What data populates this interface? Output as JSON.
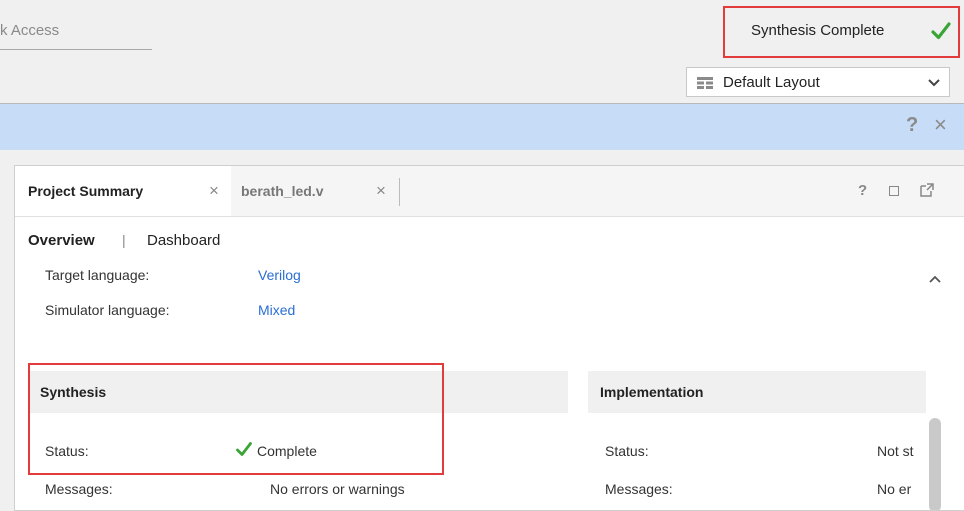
{
  "topbar": {
    "quick_access_text": "k Access",
    "status_text": "Synthesis Complete",
    "layout_label": "Default Layout"
  },
  "bluebar": {
    "help_label": "?",
    "close_label": "×"
  },
  "tabs": [
    {
      "label": "Project Summary",
      "close": "×"
    },
    {
      "label": "berath_led.v",
      "close": "×"
    }
  ],
  "panel_controls": {
    "help": "?"
  },
  "subnav": {
    "overview": "Overview",
    "separator": "|",
    "dashboard": "Dashboard"
  },
  "settings": [
    {
      "label": "Target language:",
      "value": "Verilog"
    },
    {
      "label": "Simulator language:",
      "value": "Mixed"
    }
  ],
  "synthesis": {
    "title": "Synthesis",
    "status_label": "Status:",
    "status_value": "Complete",
    "messages_label": "Messages:",
    "messages_value": "No errors or warnings"
  },
  "implementation": {
    "title": "Implementation",
    "status_label": "Status:",
    "status_value": "Not st",
    "messages_label": "Messages:",
    "messages_value": "No er"
  },
  "colors": {
    "highlight": "#e23b3b",
    "check_green": "#3aa537",
    "link_blue": "#2a6ed4",
    "bluebar": "#c7dcf7"
  }
}
